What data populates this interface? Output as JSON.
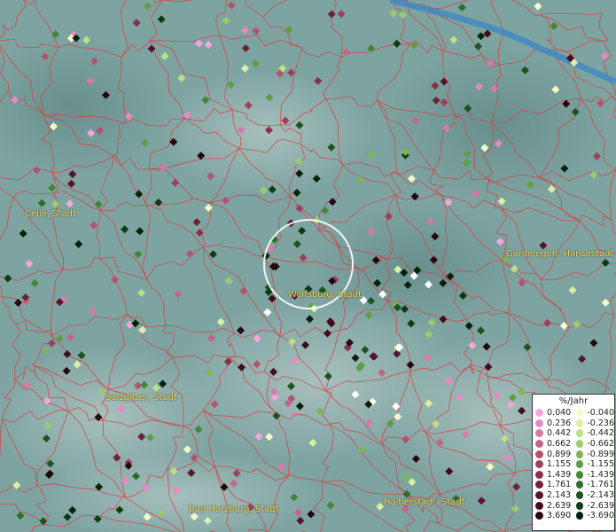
{
  "map": {
    "cities": [
      {
        "name": "Celle, Stadt"
      },
      {
        "name": "Wolfsburg, Stadt"
      },
      {
        "name": "Gardelegen, Hansestadt"
      },
      {
        "name": "Salzgitter, Stadt"
      },
      {
        "name": "Bad Harzburg, Stadt"
      },
      {
        "name": "Halberstadt, Stadt"
      }
    ]
  },
  "legend": {
    "title": "%/Jahr",
    "positive": [
      {
        "label": "0.040",
        "color": "#f4a6dc"
      },
      {
        "label": "0.236",
        "color": "#e78ac2"
      },
      {
        "label": "0.442",
        "color": "#d77aa6"
      },
      {
        "label": "0.662",
        "color": "#c26688"
      },
      {
        "label": "0.899",
        "color": "#b0546f"
      },
      {
        "label": "1.155",
        "color": "#9c415b"
      },
      {
        "label": "1.439",
        "color": "#853149"
      },
      {
        "label": "1.761",
        "color": "#6e2237"
      },
      {
        "label": "2.143",
        "color": "#571627"
      },
      {
        "label": "2.639",
        "color": "#3f0c19"
      },
      {
        "label": "3.690",
        "color": "#26050c"
      }
    ],
    "negative": [
      {
        "label": "-0.040",
        "color": "#f4fbc8"
      },
      {
        "label": "-0.236",
        "color": "#dcefa6"
      },
      {
        "label": "-0.442",
        "color": "#bddf88"
      },
      {
        "label": "-0.662",
        "color": "#9ccb6c"
      },
      {
        "label": "-0.899",
        "color": "#7cb656"
      },
      {
        "label": "-1.155",
        "color": "#5d9e45"
      },
      {
        "label": "-1.439",
        "color": "#438636"
      },
      {
        "label": "-1.761",
        "color": "#2e6d29"
      },
      {
        "label": "-2.143",
        "color": "#1c541d"
      },
      {
        "label": "-2.639",
        "color": "#0e3b12"
      },
      {
        "label": "-3.690",
        "color": "#042208"
      }
    ]
  },
  "colors": {
    "border": "#d83a3a",
    "river": "#3b86c4",
    "white_point": "#ffffff"
  }
}
